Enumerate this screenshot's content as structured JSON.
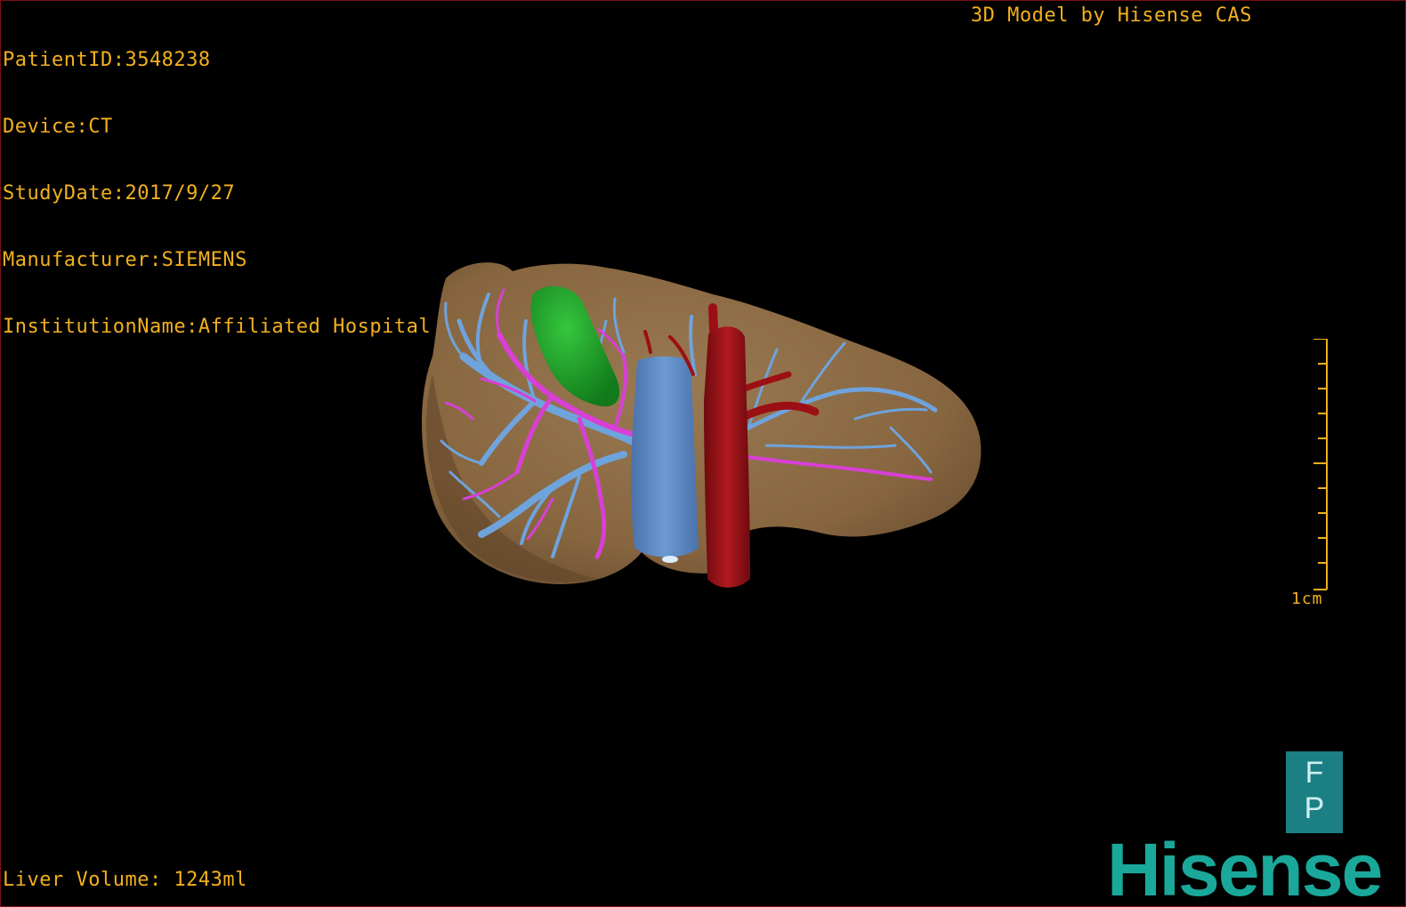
{
  "patient_info": {
    "patient_id": "PatientID:3548238",
    "device": "Device:CT",
    "study_date": "StudyDate:2017/9/27",
    "manufacturer": "Manufacturer:SIEMENS",
    "institution": "InstitutionName:Affiliated Hospital Qingdao University-C"
  },
  "watermark": "3D Model by Hisense CAS",
  "measurements": {
    "liver_volume": "Liver Volume: 1243ml"
  },
  "scale_bar": {
    "label": "1cm",
    "ticks": 10
  },
  "orientation_marker": {
    "top_letter": "F",
    "bottom_letter": "P"
  },
  "brand": "Hisense",
  "colors": {
    "overlay_text": "#f2b01e",
    "liver": "#8a6a45",
    "portal_vein": "#6fa3dc",
    "hepatic_artery": "#d93fd6",
    "vena_cava": "#5b86c4",
    "aorta": "#9c0f14",
    "gallbladder": "#1fa82a",
    "brand": "#1aa89a"
  }
}
